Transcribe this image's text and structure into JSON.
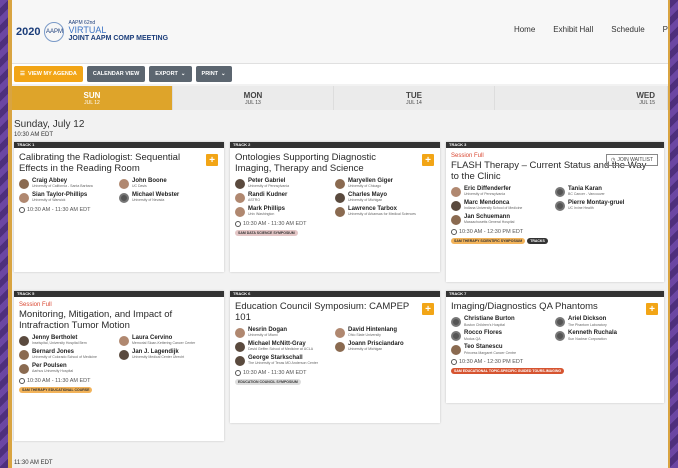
{
  "logo": {
    "year": "2020",
    "circle": "AAPM",
    "small": "AAPM 62nd",
    "virtual": "VIRTUAL",
    "main": "JOINT AAPM COMP MEETING"
  },
  "nav": [
    "Home",
    "Exhibit Hall",
    "Schedule",
    "P"
  ],
  "toolbar": {
    "agenda": "View My Agenda",
    "calendar": "Calendar View",
    "export": "Export",
    "print": "Print"
  },
  "days": [
    {
      "name": "SUN",
      "date": "JUL 12"
    },
    {
      "name": "MON",
      "date": "JUL 13"
    },
    {
      "name": "TUE",
      "date": "JUL 14"
    },
    {
      "name": "WED",
      "date": "JUL 15"
    }
  ],
  "date_heading": "Sunday, July 12",
  "time_heading": "10:30 AM EDT",
  "bottom_time": "11:30 AM EDT",
  "cards": [
    {
      "track": "TRACK 1",
      "full": "",
      "title": "Calibrating the Radiologist: Sequential Effects in the Reading Room",
      "people": [
        {
          "name": "Craig Abbey",
          "aff": "University of California - Santa Barbara"
        },
        {
          "name": "John Boone",
          "aff": "UC Davis"
        },
        {
          "name": "Sian Taylor-Phillips",
          "aff": "University of Warwick"
        },
        {
          "name": "Michael Webster",
          "aff": "University of Nevada"
        }
      ],
      "time": "10:30 AM - 11:30 AM EDT",
      "tags": []
    },
    {
      "track": "TRACK 2",
      "full": "",
      "title": "Ontologies Supporting Diagnostic Imaging, Therapy and Science",
      "people": [
        {
          "name": "Peter Gabriel",
          "aff": "University of Pennsylvania"
        },
        {
          "name": "Maryellen Giger",
          "aff": "University of Chicago"
        },
        {
          "name": "Randi Kudner",
          "aff": "ASTRO"
        },
        {
          "name": "Charles Mayo",
          "aff": "University of Michigan"
        },
        {
          "name": "Mark Phillips",
          "aff": "Univ Washington"
        },
        {
          "name": "Lawrence Tarbox",
          "aff": "University of Arkansas for Medical Sciences"
        }
      ],
      "time": "10:30 AM - 11:30 AM EDT",
      "tags": [
        "SAM DATA SCIENCE SYMPOSIUM"
      ]
    },
    {
      "track": "TRACK 3",
      "full": "Session Full",
      "title": "FLASH Therapy – Current Status and the Way to the Clinic",
      "waitlist": "JOIN WAITLIST",
      "people": [
        {
          "name": "Eric Diffenderfer",
          "aff": "University of Pennsylvania"
        },
        {
          "name": "Tania Karan",
          "aff": "BC Cancer - Vancouver"
        },
        {
          "name": "Marc Mendonca",
          "aff": "Indiana University School of Medicine"
        },
        {
          "name": "Pierre Montay-gruel",
          "aff": "UC Irvine Health"
        },
        {
          "name": "Jan Schuemann",
          "aff": "Massachusetts General Hospital"
        }
      ],
      "time": "10:30 AM - 12:30 PM EDT",
      "tags": [
        "SAM THERAPY SCIENTIFIC SYMPOSIUM",
        "TRACKS"
      ]
    },
    {
      "track": "TRACK 5",
      "full": "Session Full",
      "title": "Monitoring, Mitigation, and Impact of Intrafraction Tumor Motion",
      "people": [
        {
          "name": "Jenny Bertholet",
          "aff": "Inselspital, University Hospital Bern"
        },
        {
          "name": "Laura Cervino",
          "aff": "Memorial Sloan-Kettering Cancer Center"
        },
        {
          "name": "Bernard Jones",
          "aff": "University of Colorado School of Medicine"
        },
        {
          "name": "Jan J. Lagendijk",
          "aff": "University Medical Center Utrecht"
        },
        {
          "name": "Per Poulsen",
          "aff": "Aarhus University Hospital"
        }
      ],
      "time": "10:30 AM - 11:30 AM EDT",
      "tags": [
        "SAM THERAPY EDUCATIONAL COURSE"
      ]
    },
    {
      "track": "TRACK 6",
      "full": "",
      "title": "Education Council Symposium: CAMPEP 101",
      "people": [
        {
          "name": "Nesrin Dogan",
          "aff": "University of Miami"
        },
        {
          "name": "David Hintenlang",
          "aff": "Ohio State University"
        },
        {
          "name": "Michael McNitt-Gray",
          "aff": "David Geffen School of Medicine at UCLA"
        },
        {
          "name": "Joann Prisciandaro",
          "aff": "University of Michigan"
        },
        {
          "name": "George Starkschall",
          "aff": "The University of Texas MD Anderson Center"
        }
      ],
      "time": "10:30 AM - 11:30 AM EDT",
      "tags": [
        "EDUCATION COUNCIL SYMPOSIUM"
      ]
    },
    {
      "track": "TRACK 7",
      "full": "",
      "title": "Imaging/Diagnostics QA Phantoms",
      "people": [
        {
          "name": "Christiane Burton",
          "aff": "Boston Children's Hospital"
        },
        {
          "name": "Ariel Dickson",
          "aff": "The Phantom Laboratory"
        },
        {
          "name": "Rocco Flores",
          "aff": "Modus QA"
        },
        {
          "name": "Kenneth Ruchala",
          "aff": "Sun Nuclear Corporation"
        },
        {
          "name": "Teo Stanescu",
          "aff": "Princess Margaret Cancer Centre"
        }
      ],
      "time": "10:30 AM - 12:30 PM EDT",
      "tags": [
        "SAM EDUCATIONAL TOPIC-SPECIFIC GUIDED TOURS-IMAGING"
      ]
    }
  ]
}
